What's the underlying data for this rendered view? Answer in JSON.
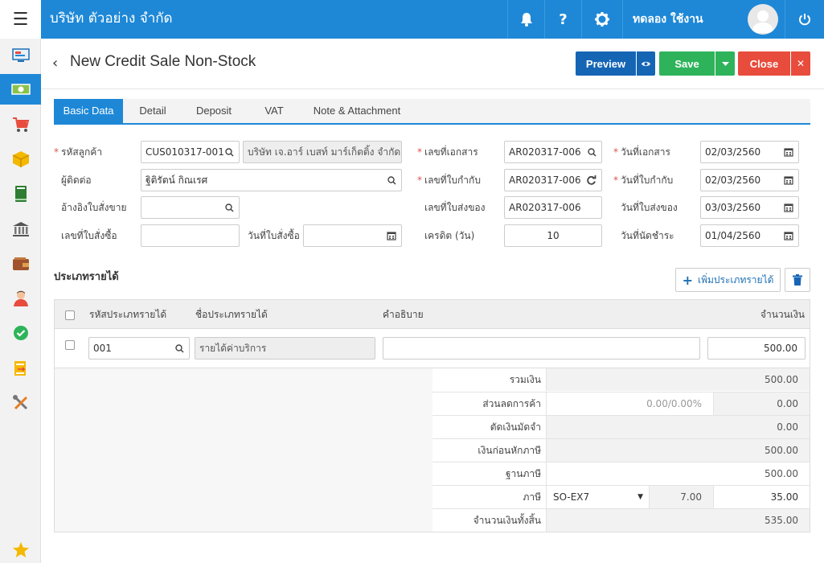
{
  "app": {
    "company": "บริษัท ตัวอย่าง จำกัด",
    "user_name": "ทดลอง ใช้งาน"
  },
  "sidebar": {
    "items": [
      "monitor-icon",
      "money-icon",
      "cart-icon",
      "box-icon",
      "book-icon",
      "bank-icon",
      "wallet-icon",
      "person-icon",
      "check-icon",
      "transfer-icon",
      "tools-icon"
    ],
    "active_index": 1,
    "favorite_icon": "star-icon"
  },
  "header": {
    "title": "New Credit Sale Non-Stock",
    "preview_label": "Preview",
    "save_label": "Save",
    "close_label": "Close"
  },
  "tabs": [
    "Basic Data",
    "Detail",
    "Deposit",
    "VAT",
    "Note & Attachment"
  ],
  "form": {
    "customer_code_label": "รหัสลูกค้า",
    "customer_code_value": "CUS010317-001",
    "customer_name_value": "บริษัท เจ.อาร์ เบสท์ มาร์เก็ตติ้ง จำกัด",
    "contact_label": "ผู้ติดต่อ",
    "contact_value": "ฐิติรัตน์ กิณเรศ",
    "ref_sales_label": "อ้างอิงใบสั่งขาย",
    "ref_sales_value": "",
    "po_no_label": "เลขที่ใบสั่งซื้อ",
    "po_no_value": "",
    "po_date_label": "วันที่ใบสั่งซื้อ",
    "po_date_value": "",
    "doc_no_label": "เลขที่เอกสาร",
    "doc_no_value": "AR020317-006",
    "tax_inv_no_label": "เลขที่ใบกำกับ",
    "tax_inv_no_value": "AR020317-006",
    "delivery_no_label": "เลขที่ใบส่งของ",
    "delivery_no_value": "AR020317-006",
    "credit_label": "เครดิต (วัน)",
    "credit_value": "10",
    "doc_date_label": "วันที่เอกสาร",
    "doc_date_value": "02/03/2560",
    "tax_inv_date_label": "วันที่ใบกำกับ",
    "tax_inv_date_value": "02/03/2560",
    "delivery_date_label": "วันที่ใบส่งของ",
    "delivery_date_value": "03/03/2560",
    "due_date_label": "วันที่นัดชำระ",
    "due_date_value": "01/04/2560"
  },
  "income": {
    "section_title": "ประเภทรายได้",
    "add_label": "เพิ่มประเภทรายได้",
    "columns": {
      "code": "รหัสประเภทรายได้",
      "name": "ชื่อประเภทรายได้",
      "desc": "คำอธิบาย",
      "amount": "จำนวนเงิน"
    },
    "rows": [
      {
        "code": "001",
        "name": "รายได้ค่าบริการ",
        "desc": "",
        "amount": "500.00"
      }
    ]
  },
  "summary": {
    "total_label": "รวมเงิน",
    "total_value": "500.00",
    "discount_label": "ส่วนลดการค้า",
    "discount_input": "0.00/0.00%",
    "discount_value": "0.00",
    "deposit_label": "ตัดเงินมัดจำ",
    "deposit_value": "0.00",
    "before_tax_label": "เงินก่อนหักภาษี",
    "before_tax_value": "500.00",
    "tax_base_label": "ฐานภาษี",
    "tax_base_value": "500.00",
    "tax_label": "ภาษี",
    "tax_code": "SO-EX7",
    "tax_rate": "7.00",
    "tax_value": "35.00",
    "grand_total_label": "จำนวนเงินทั้งสิ้น",
    "grand_total_value": "535.00"
  },
  "colors": {
    "primary": "#1e88d7",
    "preview": "#1565b5",
    "save": "#2eb35b",
    "close": "#e74c3c",
    "required": "#d9534f"
  }
}
